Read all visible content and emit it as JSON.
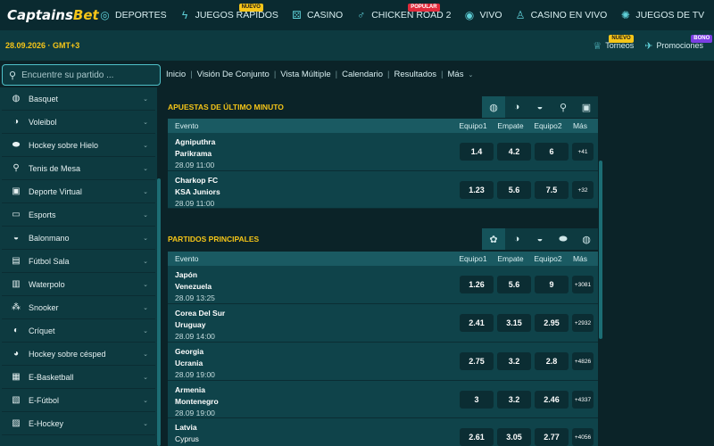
{
  "logo": {
    "captains": "Captains",
    "bet": "Bet"
  },
  "nav": [
    {
      "label": "DEPORTES",
      "icon": "globe-icon",
      "badge": ""
    },
    {
      "label": "JUEGOS RÁPIDOS",
      "icon": "lightning-icon",
      "badge": "NUEVO"
    },
    {
      "label": "CASINO",
      "icon": "dice-icon",
      "badge": ""
    },
    {
      "label": "CHICKEN ROAD 2",
      "icon": "chicken-icon",
      "badge": "POPULAR"
    },
    {
      "label": "VIVO",
      "icon": "live-icon",
      "badge": ""
    },
    {
      "label": "CASINO EN VIVO",
      "icon": "dealer-icon",
      "badge": ""
    },
    {
      "label": "JUEGOS DE TV",
      "icon": "tv-icon",
      "badge": ""
    }
  ],
  "nav_more": "•••",
  "datetime": "28.09.2026 · GMT+3",
  "subnav": [
    {
      "label": "Torneos",
      "badge": "NUEVO"
    },
    {
      "label": "Promociones",
      "badge": "BONO"
    }
  ],
  "search": {
    "placeholder": "Encuentre su partido ..."
  },
  "breadcrumbs": [
    "Inicio",
    "Visión De Conjunto",
    "Vista Múltiple",
    "Calendario",
    "Resultados",
    "Más"
  ],
  "sidebar": [
    {
      "label": "Basquet",
      "icon": "basketball-icon"
    },
    {
      "label": "Voleibol",
      "icon": "volleyball-icon"
    },
    {
      "label": "Hockey sobre Hielo",
      "icon": "puck-icon"
    },
    {
      "label": "Tenis de Mesa",
      "icon": "paddle-icon"
    },
    {
      "label": "Deporte Virtual",
      "icon": "virtual-icon"
    },
    {
      "label": "Esports",
      "icon": "gamepad-icon"
    },
    {
      "label": "Balonmano",
      "icon": "handball-icon"
    },
    {
      "label": "Fútbol Sala",
      "icon": "futsal-icon"
    },
    {
      "label": "Waterpolo",
      "icon": "waterpolo-icon"
    },
    {
      "label": "Snooker",
      "icon": "snooker-icon"
    },
    {
      "label": "Críquet",
      "icon": "cricket-icon"
    },
    {
      "label": "Hockey sobre césped",
      "icon": "fieldhockey-icon"
    },
    {
      "label": "E-Basketball",
      "icon": "ebasketball-icon"
    },
    {
      "label": "E-Fútbol",
      "icon": "efootball-icon"
    },
    {
      "label": "E-Hockey",
      "icon": "ehockey-icon"
    }
  ],
  "columns": {
    "event": "Evento",
    "team1": "Equipo1",
    "draw": "Empate",
    "team2": "Equipo2",
    "more": "Más"
  },
  "last_minute": {
    "title": "APUESTAS DE ÚLTIMO MINUTO",
    "tabs": [
      "basketball-icon",
      "volleyball-icon",
      "volleyball-icon",
      "paddle-icon",
      "virtual-icon"
    ],
    "rows": [
      {
        "team1": "Agniputhra",
        "team2": "Parikrama",
        "date": "28.09 11:00",
        "o1": "1.4",
        "x": "4.2",
        "o2": "6",
        "more": "+41"
      },
      {
        "team1": "Charkop FC",
        "team2": "KSA Juniors",
        "date": "28.09 11:00",
        "o1": "1.23",
        "x": "5.6",
        "o2": "7.5",
        "more": "+32"
      }
    ]
  },
  "main_matches": {
    "title": "PARTIDOS PRINCIPALES",
    "tabs": [
      "soccer-icon",
      "volleyball-icon",
      "volleyball-icon",
      "puck-icon",
      "tennis-icon"
    ],
    "rows": [
      {
        "team1": "Japón",
        "team2": "Venezuela",
        "date": "28.09 13:25",
        "o1": "1.26",
        "x": "5.6",
        "o2": "9",
        "more": "+3081"
      },
      {
        "team1": "Corea Del Sur",
        "team2": "Uruguay",
        "date": "28.09 14:00",
        "o1": "2.41",
        "x": "3.15",
        "o2": "2.95",
        "more": "+2932"
      },
      {
        "team1": "Georgia",
        "team2": "Ucrania",
        "date": "28.09 19:00",
        "o1": "2.75",
        "x": "3.2",
        "o2": "2.8",
        "more": "+4826"
      },
      {
        "team1": "Armenia",
        "team2": "Montenegro",
        "date": "28.09 19:00",
        "o1": "3",
        "x": "3.2",
        "o2": "2.46",
        "more": "+4337"
      },
      {
        "team1": "Latvia",
        "team2": "Cyprus",
        "date": "",
        "o1": "2.61",
        "x": "3.05",
        "o2": "2.77",
        "more": "+4056"
      }
    ]
  },
  "colors": {
    "accent": "#f5c518",
    "brand_cyan": "#4fc1c9",
    "bg": "#0b2328",
    "panel": "#0d3a40"
  }
}
